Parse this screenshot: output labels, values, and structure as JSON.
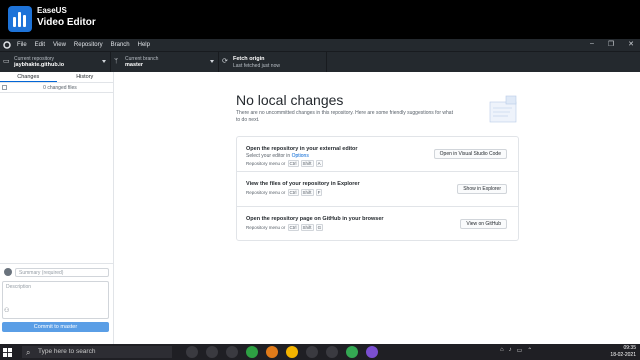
{
  "watermark": {
    "brand": "EaseUS",
    "product": "Video Editor"
  },
  "menubar": {
    "items": [
      "File",
      "Edit",
      "View",
      "Repository",
      "Branch",
      "Help"
    ],
    "controls": [
      "–",
      "❐",
      "✕"
    ]
  },
  "toolbar": {
    "repo_label": "Current repository",
    "repo_value": "jaybhakte.github.io",
    "branch_label": "Current branch",
    "branch_value": "master",
    "fetch_label": "Fetch origin",
    "fetch_status": "Last fetched just now"
  },
  "sidebar": {
    "tabs": [
      "Changes",
      "History"
    ],
    "active_tab": "Changes",
    "changed_files": "0 changed files",
    "summary_placeholder": "Summary (required)",
    "description_placeholder": "Description",
    "commit_button": "Commit to master"
  },
  "main": {
    "title": "No local changes",
    "description": "There are no uncommitted changes in this repository. Here are some friendly suggestions for what to do next.",
    "suggestions": [
      {
        "title": "Open the repository in your external editor",
        "subtitle_prefix": "Select your editor in ",
        "subtitle_link": "Options",
        "shortcut_prefix": "Repository menu or",
        "keys": [
          "Ctrl",
          "Shift",
          "A"
        ],
        "button": "Open in Visual Studio Code"
      },
      {
        "title": "View the files of your repository in Explorer",
        "shortcut_prefix": "Repository menu or",
        "keys": [
          "Ctrl",
          "Shift",
          "F"
        ],
        "button": "Show in Explorer"
      },
      {
        "title": "Open the repository page on GitHub in your browser",
        "shortcut_prefix": "Repository menu or",
        "keys": [
          "Ctrl",
          "Shift",
          "G"
        ],
        "button": "View on GitHub"
      }
    ]
  },
  "taskbar": {
    "search_placeholder": "Type here to search",
    "time": "09:35",
    "date": "18-02-2021",
    "app_colors": [
      "#3a3a40",
      "#3a3a40",
      "#3a3a40",
      "#2ea043",
      "#e07b1a",
      "#f4b400",
      "#3a3a40",
      "#3a3a40",
      "#34a853",
      "#7b4fd1"
    ]
  }
}
